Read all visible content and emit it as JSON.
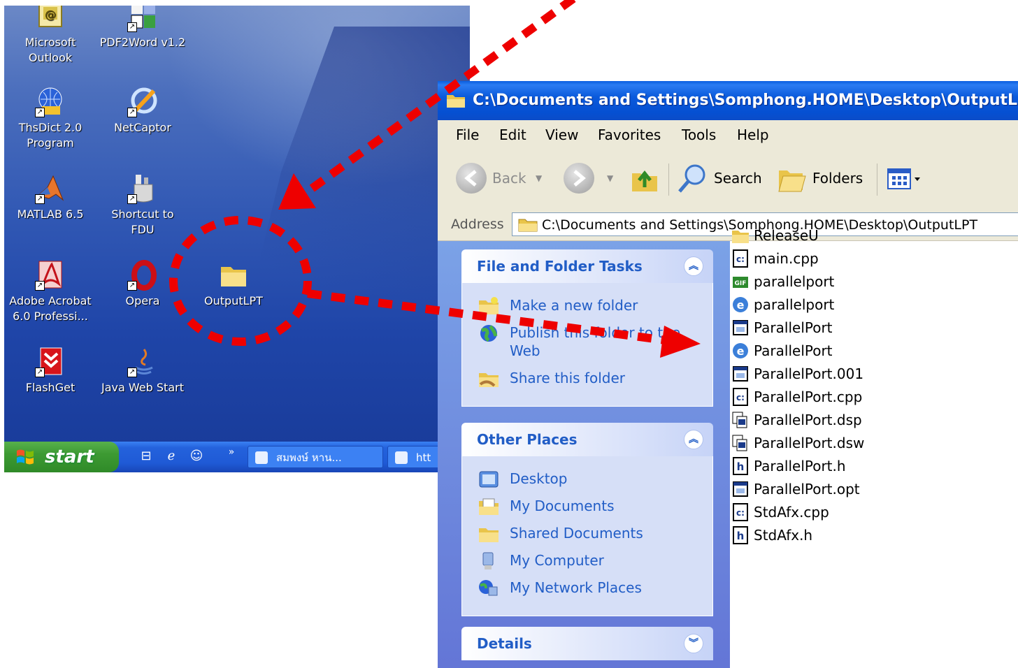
{
  "desktop": {
    "icons": [
      {
        "label": "Microsoft Outlook",
        "icon": "outlook-icon"
      },
      {
        "label": "PDF2Word v1.2",
        "icon": "pdf2word-icon"
      },
      {
        "label": "ThsDict 2.0 Program",
        "icon": "thsdict-icon"
      },
      {
        "label": "NetCaptor",
        "icon": "netcaptor-icon"
      },
      {
        "label": "MATLAB 6.5",
        "icon": "matlab-icon"
      },
      {
        "label": "Shortcut to FDU",
        "icon": "fdu-icon"
      },
      {
        "label": "Adobe Acrobat 6.0 Professi...",
        "icon": "acrobat-icon"
      },
      {
        "label": "Opera",
        "icon": "opera-icon"
      },
      {
        "label": "OutputLPT",
        "icon": "folder-icon"
      },
      {
        "label": "FlashGet",
        "icon": "flashget-icon"
      },
      {
        "label": "Java Web Start",
        "icon": "java-icon"
      }
    ]
  },
  "taskbar": {
    "start_label": "start",
    "quicklaunch_more": "»",
    "tasks": [
      {
        "label": "สมพงษ์ หาน..."
      },
      {
        "label": "htt"
      }
    ]
  },
  "explorer": {
    "title": "C:\\Documents and Settings\\Somphong.HOME\\Desktop\\OutputLPT",
    "menu": [
      "File",
      "Edit",
      "View",
      "Favorites",
      "Tools",
      "Help"
    ],
    "toolbar": {
      "back_label": "Back",
      "search_label": "Search",
      "folders_label": "Folders"
    },
    "address": {
      "label": "Address",
      "value": "C:\\Documents and Settings\\Somphong.HOME\\Desktop\\OutputLPT"
    },
    "tasks_panel": {
      "title": "File and Folder Tasks",
      "links": [
        "Make a new folder",
        "Publish this folder to the Web",
        "Share this folder"
      ]
    },
    "places_panel": {
      "title": "Other Places",
      "links": [
        "Desktop",
        "My Documents",
        "Shared Documents",
        "My Computer",
        "My Network Places"
      ]
    },
    "details_panel": {
      "title": "Details"
    },
    "files": [
      {
        "name": "ReleaseU",
        "icon": "folder-icon"
      },
      {
        "name": "main.cpp",
        "icon": "cpp-file-icon"
      },
      {
        "name": "parallelport",
        "icon": "gif-file-icon"
      },
      {
        "name": "parallelport",
        "icon": "ie-html-file-icon"
      },
      {
        "name": "ParallelPort",
        "icon": "app-window-file-icon"
      },
      {
        "name": "ParallelPort",
        "icon": "ie-html-file-icon"
      },
      {
        "name": "ParallelPort.001",
        "icon": "app-window-file-icon"
      },
      {
        "name": "ParallelPort.cpp",
        "icon": "cpp-file-icon"
      },
      {
        "name": "ParallelPort.dsp",
        "icon": "dsp-file-icon"
      },
      {
        "name": "ParallelPort.dsw",
        "icon": "dsw-file-icon"
      },
      {
        "name": "ParallelPort.h",
        "icon": "h-file-icon"
      },
      {
        "name": "ParallelPort.opt",
        "icon": "app-window-file-icon"
      },
      {
        "name": "StdAfx.cpp",
        "icon": "cpp-file-icon"
      },
      {
        "name": "StdAfx.h",
        "icon": "h-file-icon"
      }
    ]
  },
  "annotation": {
    "color": "#ee0000"
  }
}
